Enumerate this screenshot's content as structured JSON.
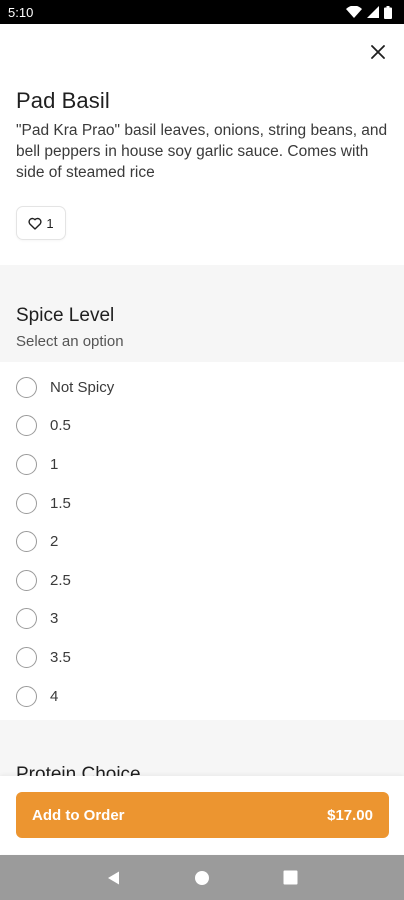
{
  "status_bar": {
    "time": "5:10"
  },
  "item": {
    "title": "Pad Basil",
    "description": "\"Pad Kra Prao\" basil leaves, onions, string beans, and bell peppers in house soy garlic sauce. Comes with side of steamed rice",
    "like_count": "1"
  },
  "spice_section": {
    "title": "Spice Level",
    "subtitle": "Select an option",
    "options": [
      "Not Spicy",
      "0.5",
      "1",
      "1.5",
      "2",
      "2.5",
      "3",
      "3.5",
      "4"
    ]
  },
  "protein_section": {
    "title": "Protein Choice"
  },
  "footer": {
    "add_label": "Add to Order",
    "price": "$17.00"
  },
  "colors": {
    "accent": "#ec9530",
    "section_bg": "#f6f6f6",
    "nav_bar": "#9b9b9b"
  },
  "icons": [
    "wifi-icon",
    "signal-icon",
    "battery-icon",
    "close-icon",
    "heart-icon",
    "back-icon",
    "home-icon",
    "recents-icon"
  ]
}
